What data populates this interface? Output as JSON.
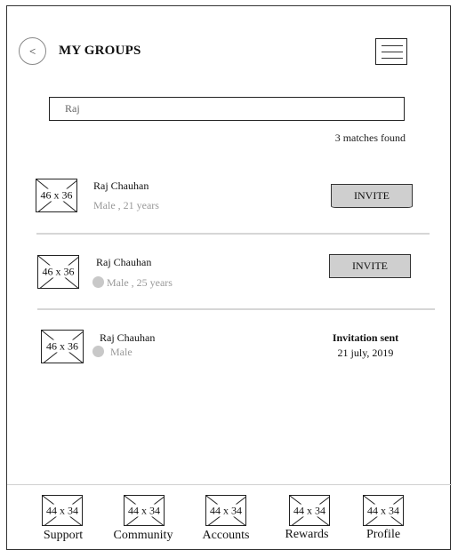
{
  "header": {
    "back_label": "<",
    "title": "MY GROUPS"
  },
  "search": {
    "value": "Raj",
    "matches": "3 matches found"
  },
  "results": [
    {
      "thumb": "46 x 36",
      "name": "Raj Chauhan",
      "meta": "Male , 21 years",
      "action_label": "INVITE"
    },
    {
      "thumb": "46 x 36",
      "name": "Raj Chauhan",
      "meta": "Male , 25 years",
      "action_label": "INVITE"
    },
    {
      "thumb": "46 x 36",
      "name": "Raj Chauhan",
      "meta": "Male",
      "status_title": "Invitation sent",
      "status_date": "21 july, 2019"
    }
  ],
  "nav": {
    "items": [
      {
        "icon": "44 x 34",
        "label": "Support"
      },
      {
        "icon": "44 x 34",
        "label": "Community"
      },
      {
        "icon": "44 x 34",
        "label": "Accounts"
      },
      {
        "icon": "44 x 34",
        "label": "Rewards"
      },
      {
        "icon": "44 x 34",
        "label": "Profile"
      }
    ]
  },
  "colors": {
    "button_bg": "#cfcfcf",
    "muted_text": "#999999",
    "divider": "#d6d6d6"
  }
}
